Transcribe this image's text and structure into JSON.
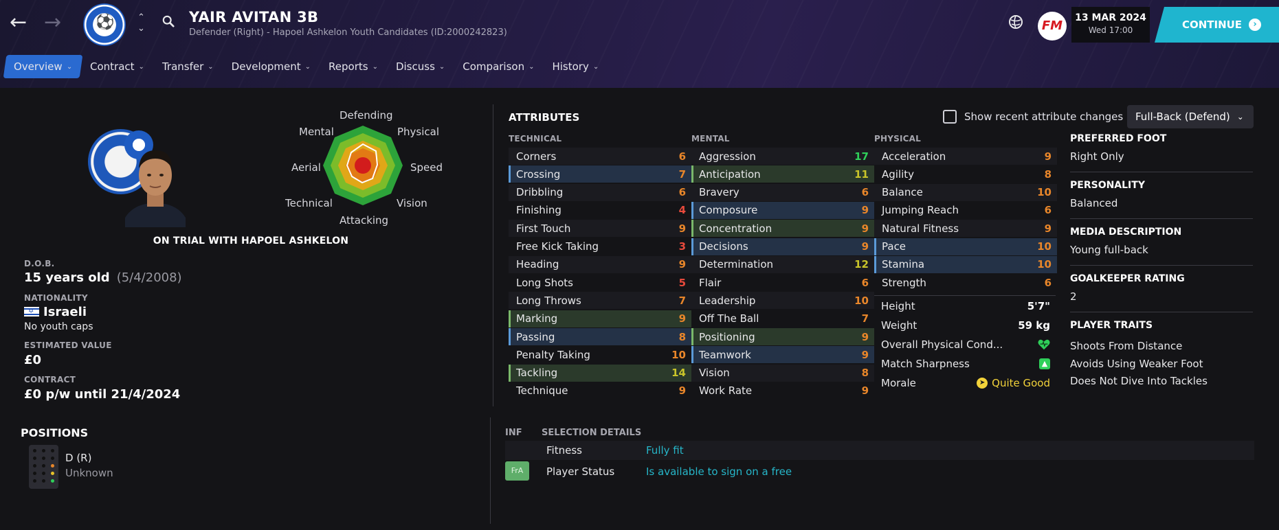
{
  "header": {
    "player_name": "YAIR AVITAN 3B",
    "player_subtitle": "Defender (Right) - Hapoel Ashkelon Youth Candidates (ID:2000242823)",
    "date": "13 MAR 2024",
    "day_time": "Wed 17:00",
    "continue_label": "CONTINUE",
    "fm_logo": "FM",
    "continue_color": "#1fb5cf"
  },
  "tabs": [
    {
      "label": "Overview",
      "active": true
    },
    {
      "label": "Contract"
    },
    {
      "label": "Transfer"
    },
    {
      "label": "Development"
    },
    {
      "label": "Reports"
    },
    {
      "label": "Discuss"
    },
    {
      "label": "Comparison"
    },
    {
      "label": "History"
    }
  ],
  "profile": {
    "trial_text": "ON TRIAL WITH HAPOEL ASHKELON",
    "radar_labels": {
      "defending": "Defending",
      "physical": "Physical",
      "speed": "Speed",
      "vision": "Vision",
      "attacking": "Attacking",
      "technical": "Technical",
      "aerial": "Aerial",
      "mental": "Mental"
    },
    "dob_label": "D.O.B.",
    "age": "15 years old",
    "dob": "(5/4/2008)",
    "nationality_label": "NATIONALITY",
    "nationality": "Israeli",
    "youth_caps": "No youth caps",
    "value_label": "ESTIMATED VALUE",
    "value": "£0",
    "contract_label": "CONTRACT",
    "contract": "£0 p/w until 21/4/2024"
  },
  "attributes": {
    "title": "ATTRIBUTES",
    "recent_changes_label": "Show recent attribute changes",
    "role": "Full-Back (Defend)",
    "technical_head": "TECHNICAL",
    "mental_head": "MENTAL",
    "physical_head": "PHYSICAL",
    "technical": [
      {
        "name": "Corners",
        "value": "6"
      },
      {
        "name": "Crossing",
        "value": "7"
      },
      {
        "name": "Dribbling",
        "value": "6"
      },
      {
        "name": "Finishing",
        "value": "4"
      },
      {
        "name": "First Touch",
        "value": "9"
      },
      {
        "name": "Free Kick Taking",
        "value": "3"
      },
      {
        "name": "Heading",
        "value": "9"
      },
      {
        "name": "Long Shots",
        "value": "5"
      },
      {
        "name": "Long Throws",
        "value": "7"
      },
      {
        "name": "Marking",
        "value": "9"
      },
      {
        "name": "Passing",
        "value": "8"
      },
      {
        "name": "Penalty Taking",
        "value": "10"
      },
      {
        "name": "Tackling",
        "value": "14"
      },
      {
        "name": "Technique",
        "value": "9"
      }
    ],
    "mental": [
      {
        "name": "Aggression",
        "value": "17"
      },
      {
        "name": "Anticipation",
        "value": "11"
      },
      {
        "name": "Bravery",
        "value": "6"
      },
      {
        "name": "Composure",
        "value": "9"
      },
      {
        "name": "Concentration",
        "value": "9"
      },
      {
        "name": "Decisions",
        "value": "9"
      },
      {
        "name": "Determination",
        "value": "12"
      },
      {
        "name": "Flair",
        "value": "6"
      },
      {
        "name": "Leadership",
        "value": "10"
      },
      {
        "name": "Off The Ball",
        "value": "7"
      },
      {
        "name": "Positioning",
        "value": "9"
      },
      {
        "name": "Teamwork",
        "value": "9"
      },
      {
        "name": "Vision",
        "value": "8"
      },
      {
        "name": "Work Rate",
        "value": "9"
      }
    ],
    "physical": [
      {
        "name": "Acceleration",
        "value": "9"
      },
      {
        "name": "Agility",
        "value": "8"
      },
      {
        "name": "Balance",
        "value": "10"
      },
      {
        "name": "Jumping Reach",
        "value": "6"
      },
      {
        "name": "Natural Fitness",
        "value": "9"
      },
      {
        "name": "Pace",
        "value": "10"
      },
      {
        "name": "Stamina",
        "value": "10"
      },
      {
        "name": "Strength",
        "value": "6"
      }
    ],
    "height_label": "Height",
    "height": "5'7\"",
    "weight_label": "Weight",
    "weight": "59 kg",
    "condition_label": "Overall Physical Cond...",
    "sharpness_label": "Match Sharpness",
    "morale_label": "Morale",
    "morale": "Quite Good"
  },
  "side_info": {
    "foot_label": "PREFERRED FOOT",
    "foot": "Right Only",
    "personality_label": "PERSONALITY",
    "personality": "Balanced",
    "media_label": "MEDIA DESCRIPTION",
    "media": "Young full-back",
    "gk_label": "GOALKEEPER RATING",
    "gk": "2",
    "traits_label": "PLAYER TRAITS",
    "traits": [
      "Shoots From Distance",
      "Avoids Using Weaker Foot",
      "Does Not Dive Into Tackles"
    ]
  },
  "positions": {
    "title": "POSITIONS",
    "position": "D (R)",
    "level": "Unknown"
  },
  "selection": {
    "inf_head": "INF",
    "details_head": "SELECTION DETAILS",
    "fitness_label": "Fitness",
    "fitness": "Fully fit",
    "status_badge": "FrA",
    "status_label": "Player Status",
    "status": "Is available to sign on a free"
  }
}
